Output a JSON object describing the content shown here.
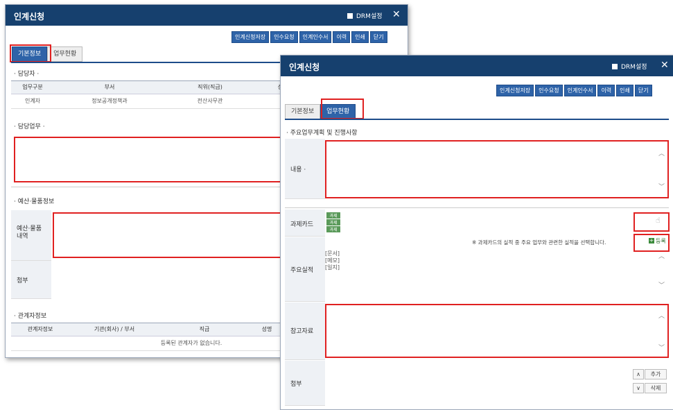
{
  "win1": {
    "title": "인계신청",
    "drm": "DRM설정",
    "close": "✕",
    "buttons": [
      "인계신청저장",
      "인수요청",
      "인계인수서",
      "이력",
      "인쇄",
      "닫기"
    ],
    "tabs": [
      "기본정보",
      "업무현황"
    ],
    "section_manager": "· 담당자 ·",
    "table_headers": [
      "업무구분",
      "부서",
      "직위(직급)",
      "성명"
    ],
    "table_row": [
      "인계자",
      "정보공개정책과",
      "전산사무관",
      ""
    ],
    "section_duty": "· 담당업무 ·",
    "section_budget": "· 예산·물품정보",
    "budget_label": "예산·물품\n내역",
    "attach_label": "첨부",
    "section_related": "· 관계자정보",
    "related_headers": [
      "관계자정보",
      "기관(회사) / 부서",
      "직급",
      "성명"
    ],
    "related_empty": "등록된 관계자가 없습니다."
  },
  "win2": {
    "title": "인계신청",
    "drm": "DRM설정",
    "close": "✕",
    "buttons": [
      "인계신청저장",
      "인수요청",
      "인계인수서",
      "이력",
      "인쇄",
      "닫기"
    ],
    "tabs": [
      "기본정보",
      "업무현황"
    ],
    "section_plan": "· 주요업무계획 및 진행사항",
    "content_label": "내용 ·",
    "task_card_label": "과제카드",
    "chips": [
      "과제",
      "과제",
      "과제"
    ],
    "notice": "※ 과제카드의 실적 중 주요 업무와 관련한 실적을 선택합니다.",
    "register_label": "등록",
    "main_perf_label": "주요실적",
    "perf_items": [
      "[문서]",
      "[메모]",
      "[일지]"
    ],
    "ref_label": "참고자료",
    "attach_label": "첨부",
    "add_label": "추가",
    "delete_label": "삭제"
  }
}
